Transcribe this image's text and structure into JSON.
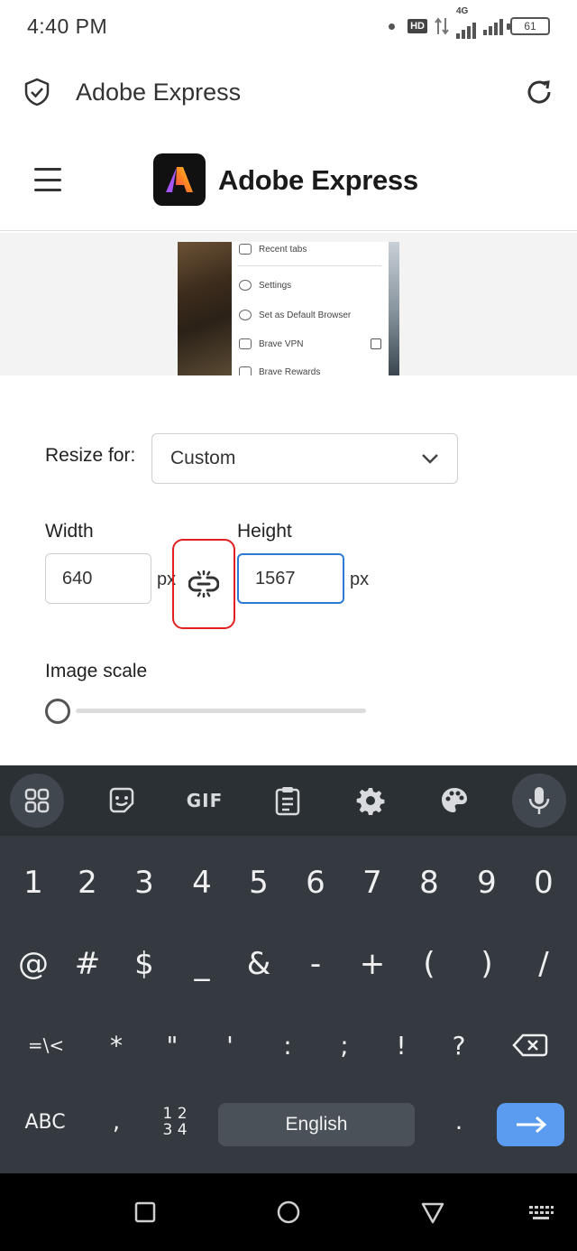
{
  "status_bar": {
    "time": "4:40 PM",
    "hd_badge": "HD",
    "network_type": "4G",
    "battery": "61"
  },
  "browser": {
    "tab_title": "Adobe Express"
  },
  "header": {
    "brand_name": "Adobe Express"
  },
  "preview": {
    "menu_items": [
      "Recent tabs",
      "Settings",
      "Set as Default Browser",
      "Brave VPN",
      "Brave Rewards"
    ]
  },
  "form": {
    "resize_label": "Resize for:",
    "resize_value": "Custom",
    "width_label": "Width",
    "width_value": "640",
    "height_label": "Height",
    "height_value": "1567",
    "unit": "px",
    "scale_label": "Image scale",
    "scale_value": 0
  },
  "keyboard": {
    "toolbar_gif": "GIF",
    "row_numbers": [
      "1",
      "2",
      "3",
      "4",
      "5",
      "6",
      "7",
      "8",
      "9",
      "0"
    ],
    "row_symbols1": [
      "@",
      "#",
      "$",
      "_",
      "&",
      "-",
      "+",
      "(",
      ")",
      "/"
    ],
    "row_symbols2": [
      "=\\<",
      "*",
      "\"",
      "'",
      ":",
      ";",
      "!",
      "?"
    ],
    "abc_key": "ABC",
    "comma_key": ",",
    "numpad_key_top": "1 2",
    "numpad_key_bottom": "3 4",
    "space_label": "English",
    "period_key": "."
  },
  "colors": {
    "accent_blue": "#2b7ad6",
    "highlight_red": "#e02020",
    "keyboard_bg": "#343a40",
    "enter_key": "#5b9cf0"
  }
}
